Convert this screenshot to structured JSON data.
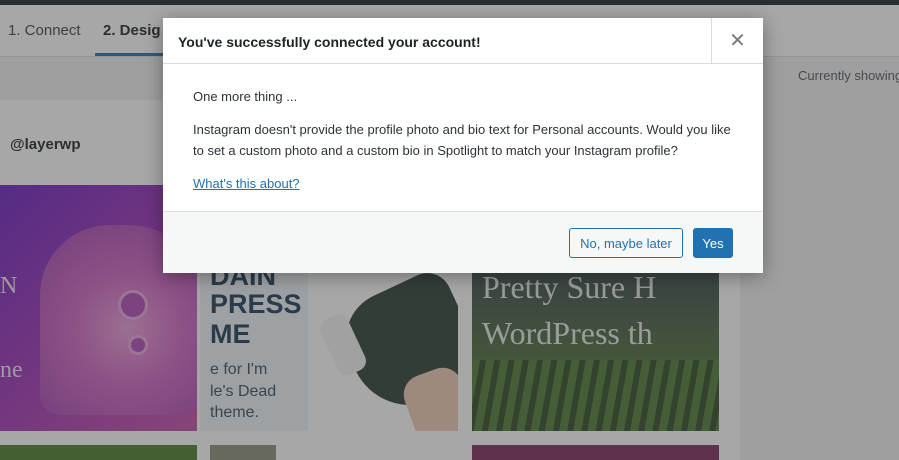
{
  "steps": [
    {
      "label": "1. Connect"
    },
    {
      "label": "2. Desig"
    }
  ],
  "status": {
    "currently_showing": "Currently showing"
  },
  "preview": {
    "username": "@layerwp",
    "tile1": {
      "lines": [
        "N",
        "ne"
      ]
    },
    "tile2": {
      "big_lines": [
        "DAIN",
        "PRESS",
        "ME"
      ],
      "small_lines": [
        "e for I'm",
        "le's Dead",
        "theme."
      ]
    },
    "tile3": {
      "lines": [
        "Pretty Sure H",
        "WordPress th"
      ]
    }
  },
  "modal": {
    "title": "You've successfully connected your account!",
    "close_icon": "close-icon",
    "body_lead": "One more thing ...",
    "body_text": "Instagram doesn't provide the profile photo and bio text for Personal accounts. Would you like to set a custom photo and a custom bio in Spotlight to match your Instagram profile?",
    "link": "What's this about?",
    "secondary_button": "No, maybe later",
    "primary_button": "Yes"
  },
  "colors": {
    "accent": "#2271b1",
    "overlay": "rgba(60,60,60,0.45)"
  }
}
